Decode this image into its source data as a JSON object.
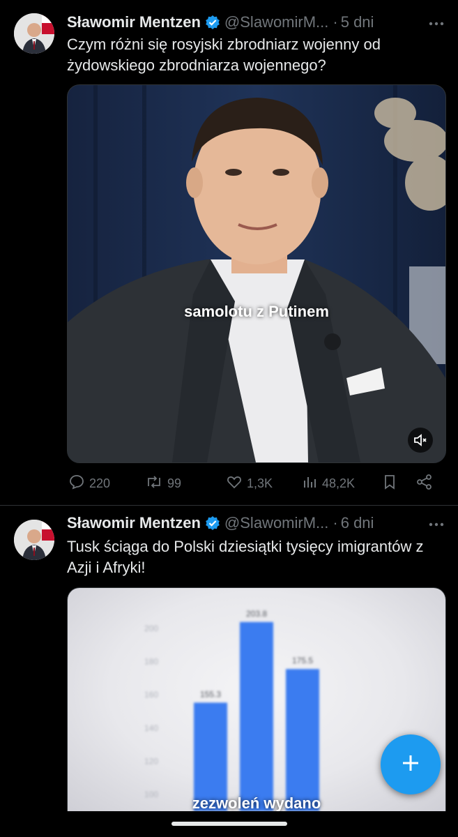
{
  "tweets": [
    {
      "author": "Sławomir Mentzen",
      "handle": "@SlawomirM...",
      "time": "5 dni",
      "text": "Czym różni się rosyjski zbrodniarz wojenny od żydowskiego zbrodniarza wojennego?",
      "video_caption": "samolotu z Putinem",
      "replies": "220",
      "reposts": "99",
      "likes": "1,3K",
      "views": "48,2K"
    },
    {
      "author": "Sławomir Mentzen",
      "handle": "@SlawomirM...",
      "time": "6 dni",
      "text": "Tusk ściąga do Polski dziesiątki tysięcy imigrantów z Azji i Afryki!",
      "video_caption": "zezwoleń wydano"
    }
  ],
  "chart_data": {
    "type": "bar",
    "categories": [
      "",
      "",
      ""
    ],
    "values": [
      155.3,
      203.8,
      175.5
    ],
    "data_labels": [
      "155.3",
      "203.8",
      "175.5"
    ],
    "yticks": [
      "200",
      "180",
      "160",
      "140",
      "120",
      "100"
    ],
    "ylim": [
      90,
      210
    ],
    "color": "#3a7bf0"
  },
  "colors": {
    "accent": "#1d9bf0",
    "muted": "#71767b",
    "text": "#e7e9ea"
  },
  "icons": [
    "verified-badge-icon",
    "more-icon",
    "reply-icon",
    "repost-icon",
    "like-icon",
    "views-icon",
    "bookmark-icon",
    "share-icon",
    "mute-icon",
    "compose-icon"
  ]
}
